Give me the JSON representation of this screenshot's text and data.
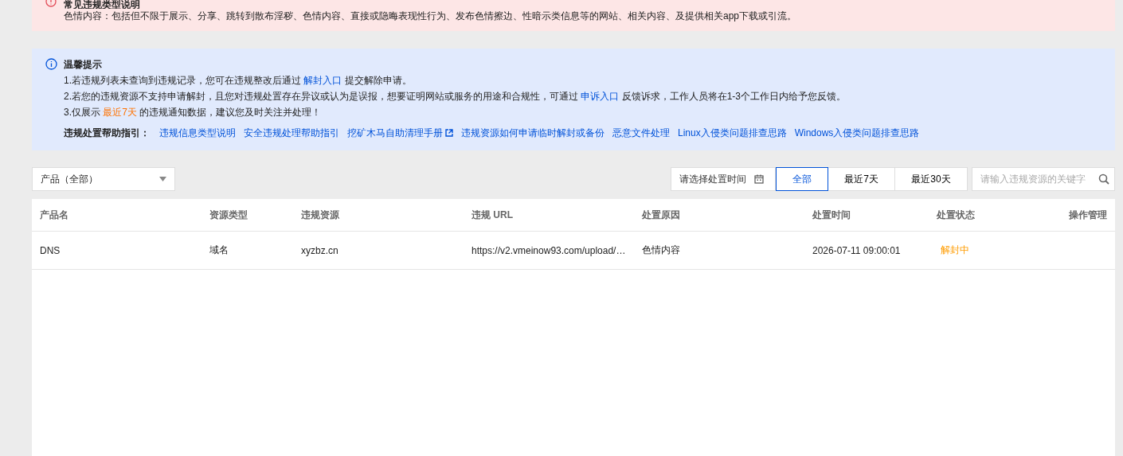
{
  "violation_banner": {
    "title": "常见违规类型说明",
    "text": "色情内容：包括但不限于展示、分享、跳转到散布淫秽、色情内容、直接或隐晦表现性行为、发布色情擦边、性暗示类信息等的网站、相关内容、及提供相关app下载或引流。"
  },
  "notice": {
    "title": "温馨提示",
    "lines": [
      [
        {
          "text": "1.若违规列表未查询到违规记录，您可在违规整改后通过 "
        },
        {
          "text": "解封入口",
          "kind": "link"
        },
        {
          "text": " 提交解除申请。"
        }
      ],
      [
        {
          "text": "2.若您的违规资源不支持申请解封，且您对违规处置存在异议或认为是误报，想要证明网站或服务的用途和合规性，可通过 "
        },
        {
          "text": "申诉入口",
          "kind": "link"
        },
        {
          "text": " 反馈诉求，工作人员将在1-3个工作日内给予您反馈。"
        }
      ],
      [
        {
          "text": "3.仅展示 "
        },
        {
          "text": "最近7天",
          "kind": "highlight"
        },
        {
          "text": " 的违规通知数据，建议您及时关注并处理！"
        }
      ]
    ],
    "help_label": "违规处置帮助指引：",
    "help_links": [
      {
        "text": "违规信息类型说明",
        "external": false
      },
      {
        "text": "安全违规处理帮助指引",
        "external": false
      },
      {
        "text": "挖矿木马自助清理手册",
        "external": true
      },
      {
        "text": "违规资源如何申请临时解封或备份",
        "external": false
      },
      {
        "text": "恶意文件处理",
        "external": false
      },
      {
        "text": "Linux入侵类问题排查思路",
        "external": false
      },
      {
        "text": "Windows入侵类问题排查思路",
        "external": false
      }
    ]
  },
  "toolbar": {
    "product_select": "产品（全部）",
    "date_picker": {
      "placeholder": "请选择处置时间"
    },
    "range_tabs": [
      {
        "label": "全部",
        "selected": true
      },
      {
        "label": "最近7天",
        "selected": false
      },
      {
        "label": "最近30天",
        "selected": false
      }
    ],
    "search": {
      "placeholder": "请输入违规资源的关键字"
    }
  },
  "table": {
    "columns": [
      "产品名",
      "资源类型",
      "违规资源",
      "违规 URL",
      "处置原因",
      "处置时间",
      "处置状态",
      "操作管理"
    ],
    "rows": [
      {
        "cells": [
          "DNS",
          "域名",
          "xyzbz.cn",
          "https://v2.vmeinow93.com/upload/…",
          "色情内容",
          "2026-07-11 09:00:01"
        ],
        "status": "解封中"
      }
    ]
  }
}
